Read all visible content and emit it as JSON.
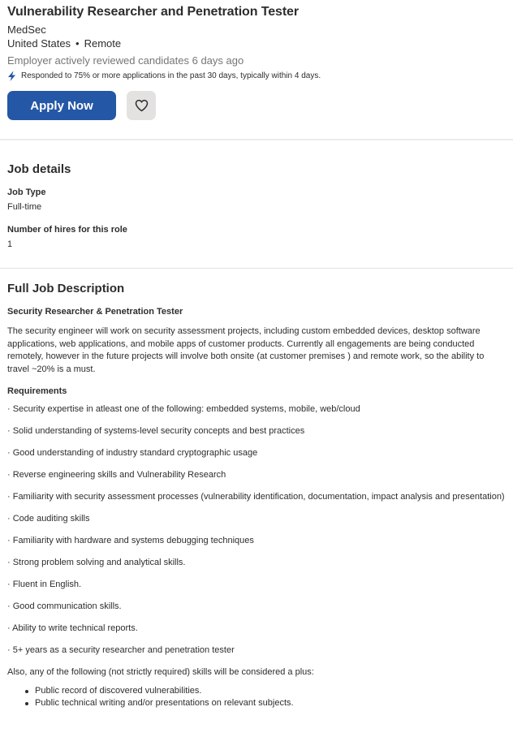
{
  "job": {
    "title": "Vulnerability Researcher and Penetration Tester",
    "company": "MedSec",
    "country": "United States",
    "separator": "•",
    "work_mode": "Remote",
    "reviewed": "Employer actively reviewed candidates 6 days ago",
    "responded": "Responded to 75% or more applications in the past 30 days, typically within 4 days."
  },
  "actions": {
    "apply_label": "Apply Now",
    "save_icon": "heart-icon"
  },
  "details": {
    "heading": "Job details",
    "job_type_label": "Job Type",
    "job_type_value": "Full-time",
    "hires_label": "Number of hires for this role",
    "hires_value": "1"
  },
  "description": {
    "heading": "Full Job Description",
    "subtitle": "Security Researcher & Penetration Tester",
    "intro": "The security engineer will work on security assessment projects, including custom embedded devices, desktop software applications, web applications, and mobile apps of customer products. Currently all engagements are being conducted remotely, however in the future projects will involve both onsite (at customer premises ) and remote work, so the ability to travel ~20% is a must.",
    "requirements_heading": "Requirements",
    "requirements": [
      "· Security expertise in atleast one of the following: embedded systems, mobile, web/cloud",
      "· Solid understanding of systems-level security concepts and best practices",
      "· Good understanding of industry standard cryptographic usage",
      "· Reverse engineering skills and Vulnerability Research",
      "· Familiarity with security assessment processes (vulnerability identification, documentation, impact analysis and presentation)",
      "· Code auditing skills",
      "· Familiarity with hardware and systems debugging techniques",
      "· Strong problem solving and analytical skills.",
      "· Fluent in English.",
      "· Good communication skills.",
      "· Ability to write technical reports.",
      "· 5+ years as a security researcher and penetration tester"
    ],
    "plus_intro": "Also, any of the following (not strictly required) skills will be considered a plus:",
    "plus_items": [
      "Public record of discovered vulnerabilities.",
      "Public technical writing and/or presentations on relevant subjects."
    ]
  },
  "colors": {
    "primary": "#2557a7",
    "text": "#2d2d2d",
    "muted": "#767676",
    "save_bg": "#e4e2e0"
  }
}
